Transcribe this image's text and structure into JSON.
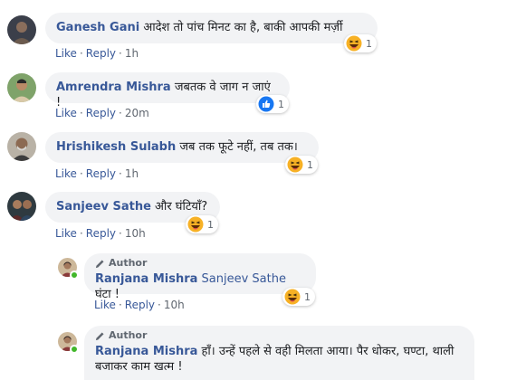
{
  "comments": [
    {
      "name": "Ganesh Gani",
      "text": "आदेश तो पांच मिनट का है, बाकी आपकी मर्ज़ी",
      "like": "Like",
      "reply": "Reply",
      "time": "1h",
      "reaction_icon": "haha-icon",
      "reaction_count": "1"
    },
    {
      "name": "Amrendra Mishra",
      "text": "जबतक वे जाग न जाएं !",
      "like": "Like",
      "reply": "Reply",
      "time": "20m",
      "reaction_icon": "like-icon",
      "reaction_count": "1"
    },
    {
      "name": "Hrishikesh Sulabh",
      "text": "जब तक फूटे नहीं, तब तक।",
      "like": "Like",
      "reply": "Reply",
      "time": "1h",
      "reaction_icon": "haha-icon",
      "reaction_count": "1"
    },
    {
      "name": "Sanjeev Sathe",
      "text": "और घंटियाँ?",
      "like": "Like",
      "reply": "Reply",
      "time": "10h",
      "reaction_icon": "haha-icon",
      "reaction_count": "1"
    }
  ],
  "replies": [
    {
      "author_tag": "Author",
      "name": "Ranjana Mishra",
      "mention": "Sanjeev Sathe",
      "text": "घंटा !",
      "like": "Like",
      "reply": "Reply",
      "time": "10h",
      "reaction_icon": "haha-icon",
      "reaction_count": "1"
    },
    {
      "author_tag": "Author",
      "name": "Ranjana Mishra",
      "text": "हाँ। उन्हें पहले से वही मिलता आया। पैर धोकर, घण्टा, थाली बजाकर काम खत्म !"
    }
  ],
  "colors": {
    "link": "#385898",
    "bubble": "#f2f3f5",
    "meta": "#606770",
    "online": "#42b72a",
    "like_blue": "#1877f2",
    "haha_yellow": "#f7b125"
  }
}
